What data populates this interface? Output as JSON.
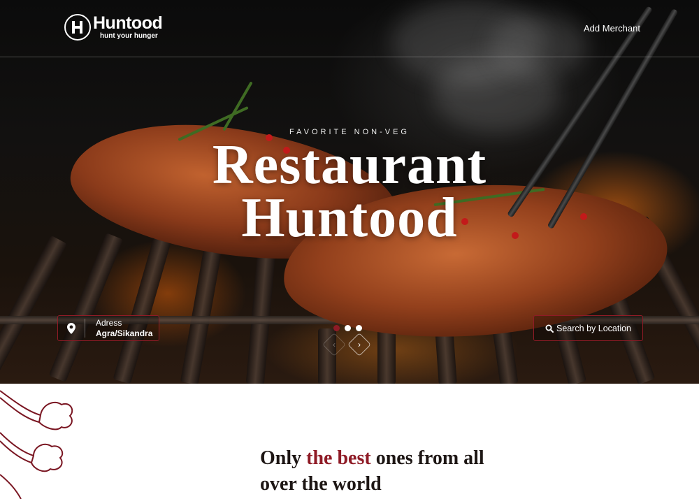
{
  "brand": {
    "name": "Huntood",
    "tagline": "hunt your hunger"
  },
  "nav": {
    "add_merchant_label": "Add Merchant"
  },
  "hero": {
    "eyebrow": "FAVORITE NON-VEG",
    "title_line1": "Restaurant",
    "title_line2": "Huntood",
    "slide_count": 3,
    "active_slide": 1
  },
  "search": {
    "address_label": "Adress",
    "address_value": "Agra/Sikandra",
    "search_button_label": "Search by Location"
  },
  "section": {
    "tagline_before": "Only ",
    "tagline_accent": "the best",
    "tagline_after_line1": " ones from all",
    "tagline_line2": "over the world"
  },
  "colors": {
    "accent": "#8f1b26",
    "heading": "#1d1614"
  },
  "icons": {
    "address": "map-pin-icon",
    "search": "search-icon",
    "prev": "chevron-left-icon",
    "next": "chevron-right-icon"
  }
}
